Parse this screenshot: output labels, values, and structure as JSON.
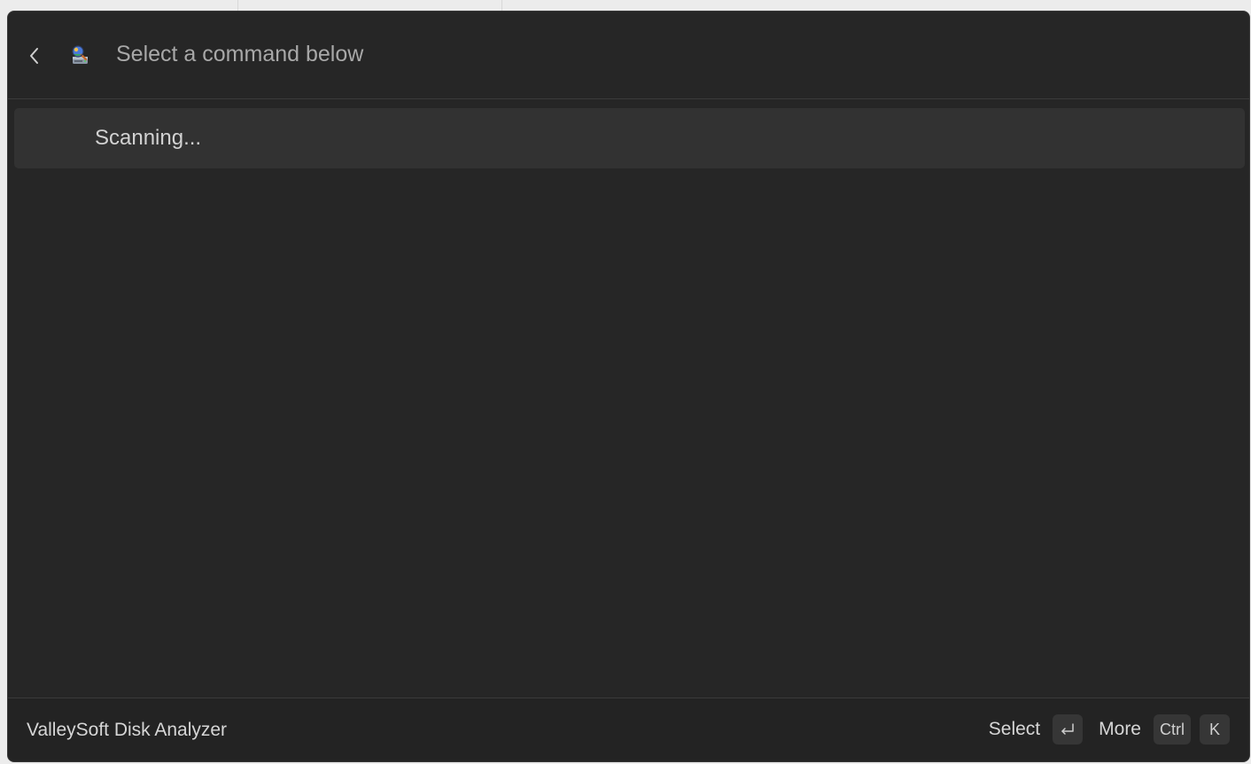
{
  "header": {
    "back_icon": "chevron-left-icon",
    "app_icon": "disk-analyzer-app-icon",
    "search_placeholder": "Select a command below",
    "search_value": ""
  },
  "list": {
    "items": [
      {
        "label": "Scanning..."
      }
    ]
  },
  "footer": {
    "title": "ValleySoft Disk Analyzer",
    "select_label": "Select",
    "select_key_icon": "enter-key-icon",
    "more_label": "More",
    "more_keys": [
      "Ctrl",
      "K"
    ]
  },
  "colors": {
    "window_bg": "#262626",
    "selected_item_bg": "#323232",
    "text_primary": "#d6d6d6",
    "placeholder": "#a8a8a8"
  }
}
